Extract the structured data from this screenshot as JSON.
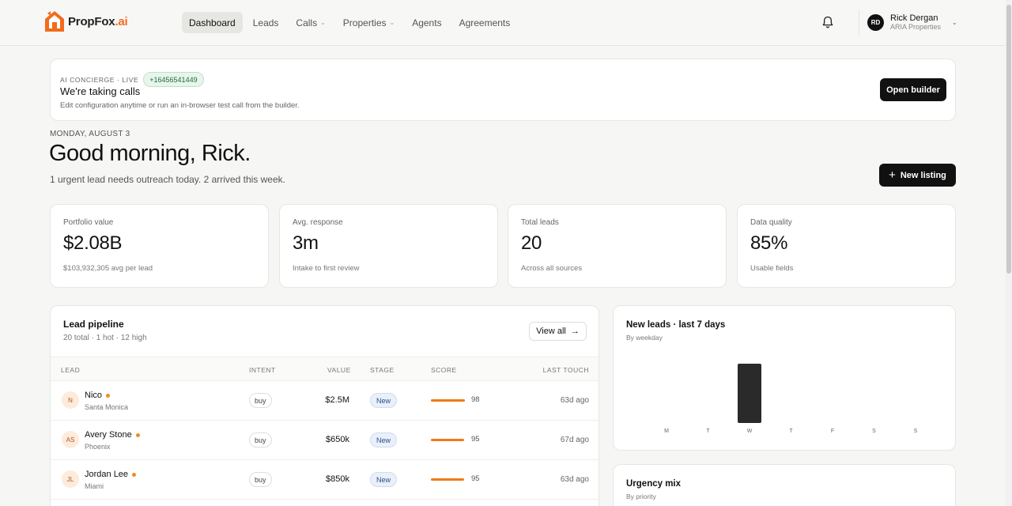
{
  "app": {
    "logo_name": "PropFox",
    "logo_suffix": ".ai",
    "brand_color": "#f26b1d"
  },
  "nav": [
    {
      "label": "Dashboard",
      "active": true,
      "dropdown": false
    },
    {
      "label": "Leads",
      "active": false,
      "dropdown": false
    },
    {
      "label": "Calls",
      "active": false,
      "dropdown": true
    },
    {
      "label": "Properties",
      "active": false,
      "dropdown": true
    },
    {
      "label": "Agents",
      "active": false,
      "dropdown": false
    },
    {
      "label": "Agreements",
      "active": false,
      "dropdown": false
    }
  ],
  "user": {
    "initials": "RD",
    "name": "Rick Dergan",
    "org": "ARIA Properties"
  },
  "concierge": {
    "kicker": "AI CONCIERGE · LIVE",
    "phone": "+16456541449",
    "title": "We're taking calls",
    "subtitle": "Edit configuration anytime or run an in-browser test call from the builder.",
    "button": "Open builder"
  },
  "greeting": {
    "date": "MONDAY, AUGUST 3",
    "headline": "Good morning, Rick.",
    "summary": "1 urgent lead needs outreach today. 2 arrived this week.",
    "new_listing_label": "New listing"
  },
  "stats": [
    {
      "label": "Portfolio value",
      "value": "$2.08B",
      "sub": "$103,932,305 avg per lead"
    },
    {
      "label": "Avg. response",
      "value": "3m",
      "sub": "Intake to first review"
    },
    {
      "label": "Total leads",
      "value": "20",
      "sub": "Across all sources"
    },
    {
      "label": "Data quality",
      "value": "85%",
      "sub": "Usable fields"
    }
  ],
  "pipeline": {
    "title": "Lead pipeline",
    "subtitle": "20 total · 1 hot · 12 high",
    "view_all": "View all",
    "columns": {
      "lead": "LEAD",
      "intent": "INTENT",
      "value": "VALUE",
      "stage": "STAGE",
      "score": "SCORE",
      "last_touch": "LAST TOUCH"
    },
    "rows": [
      {
        "initials": "N",
        "name": "Nico",
        "location": "Santa Monica",
        "intent": "buy",
        "value": "$2.5M",
        "stage": "New",
        "score": "98",
        "score_pct": 0.98,
        "last_touch": "63d ago"
      },
      {
        "initials": "AS",
        "name": "Avery Stone",
        "location": "Phoenix",
        "intent": "buy",
        "value": "$650k",
        "stage": "New",
        "score": "95",
        "score_pct": 0.95,
        "last_touch": "67d ago"
      },
      {
        "initials": "JL",
        "name": "Jordan Lee",
        "location": "Miami",
        "intent": "buy",
        "value": "$850k",
        "stage": "New",
        "score": "95",
        "score_pct": 0.95,
        "last_touch": "63d ago"
      }
    ]
  },
  "new_leads": {
    "title": "New leads · last 7 days",
    "subtitle": "By weekday"
  },
  "urgency": {
    "title": "Urgency mix",
    "subtitle": "By priority"
  },
  "chart_data": {
    "type": "bar",
    "title": "New leads · last 7 days",
    "subtitle": "By weekday",
    "categories": [
      "M",
      "T",
      "W",
      "T",
      "F",
      "S",
      "S"
    ],
    "values": [
      0,
      0,
      2,
      0,
      0,
      0,
      0
    ],
    "ylim": [
      0,
      2
    ],
    "grid": false,
    "bar_color": "#2a2a2a"
  }
}
